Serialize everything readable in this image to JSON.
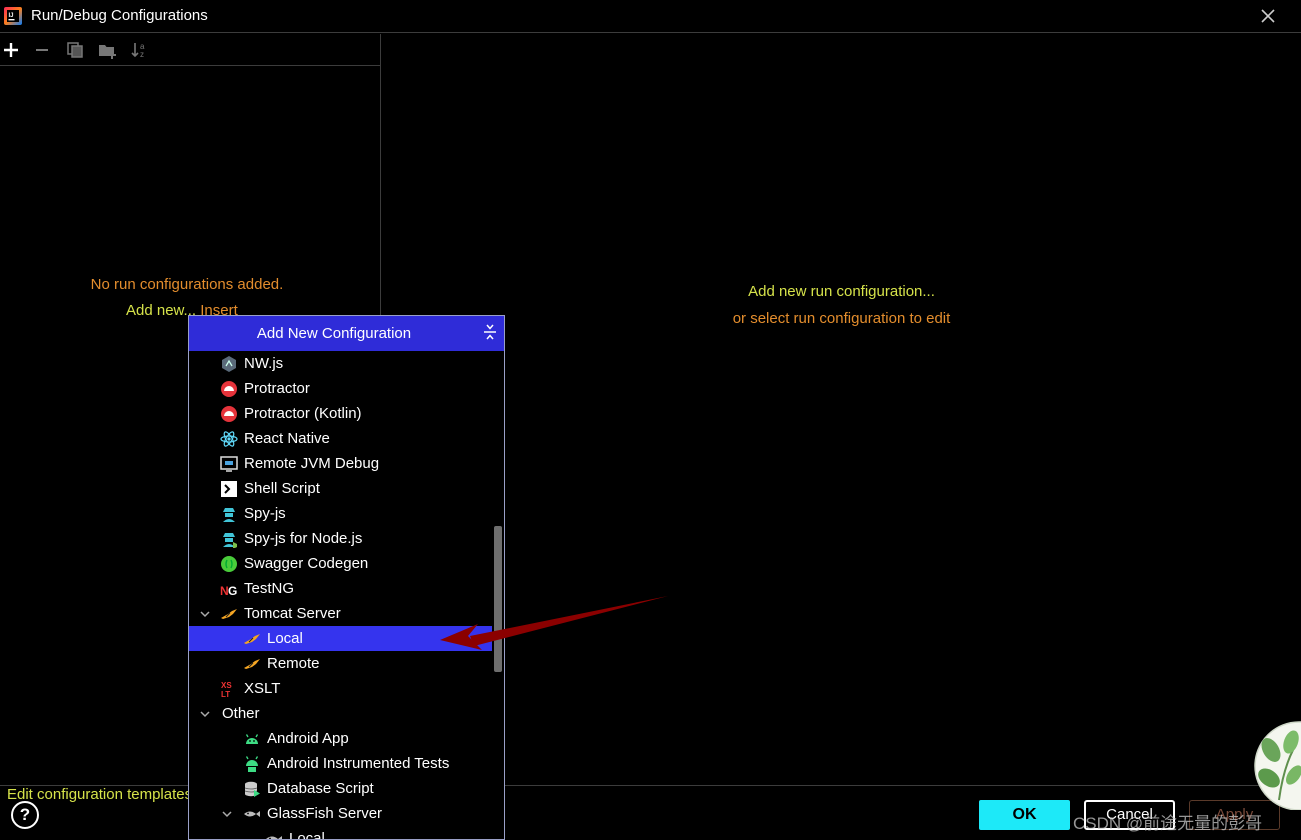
{
  "window": {
    "title": "Run/Debug Configurations"
  },
  "left_panel": {
    "empty_message": "No run configurations added.",
    "add_new_label": "Add new...",
    "insert_shortcut": "Insert",
    "edit_templates_link": "Edit configuration templates..."
  },
  "right_panel": {
    "add_new_message": "Add new run configuration...",
    "select_message": "or select run configuration to edit"
  },
  "popup": {
    "title": "Add New Configuration",
    "items": [
      {
        "label": "NW.js",
        "icon": "nwjs-icon"
      },
      {
        "label": "Protractor",
        "icon": "protractor-icon"
      },
      {
        "label": "Protractor (Kotlin)",
        "icon": "protractor-icon"
      },
      {
        "label": "React Native",
        "icon": "react-icon"
      },
      {
        "label": "Remote JVM Debug",
        "icon": "remote-debug-icon"
      },
      {
        "label": "Shell Script",
        "icon": "shell-script-icon"
      },
      {
        "label": "Spy-js",
        "icon": "spy-js-icon"
      },
      {
        "label": "Spy-js for Node.js",
        "icon": "spy-js-node-icon"
      },
      {
        "label": "Swagger Codegen",
        "icon": "swagger-icon"
      },
      {
        "label": "TestNG",
        "icon": "testng-icon"
      },
      {
        "label": "Tomcat Server",
        "icon": "tomcat-icon",
        "expanded": true
      },
      {
        "label": "Local",
        "icon": "tomcat-icon",
        "selected": true
      },
      {
        "label": "Remote",
        "icon": "tomcat-icon"
      },
      {
        "label": "XSLT",
        "icon": "xslt-icon"
      },
      {
        "label": "Other",
        "expanded": true
      },
      {
        "label": "Android App",
        "icon": "android-icon"
      },
      {
        "label": "Android Instrumented Tests",
        "icon": "android-test-icon"
      },
      {
        "label": "Database Script",
        "icon": "database-script-icon"
      },
      {
        "label": "GlassFish Server",
        "icon": "glassfish-icon",
        "expanded": true
      },
      {
        "label": "Local",
        "icon": "glassfish-icon"
      }
    ]
  },
  "buttons": {
    "help": "?",
    "ok": "OK",
    "cancel": "Cancel",
    "apply": "Apply"
  },
  "watermark": "CSDN @前途无量的彭哥",
  "colors": {
    "accent_yellow": "#d6e34a",
    "accent_orange": "#e38d2d",
    "popup_header": "#2f2cd8",
    "selection": "#3534ee",
    "ok_button": "#1de9f8",
    "annotation_arrow": "#8b0000"
  }
}
